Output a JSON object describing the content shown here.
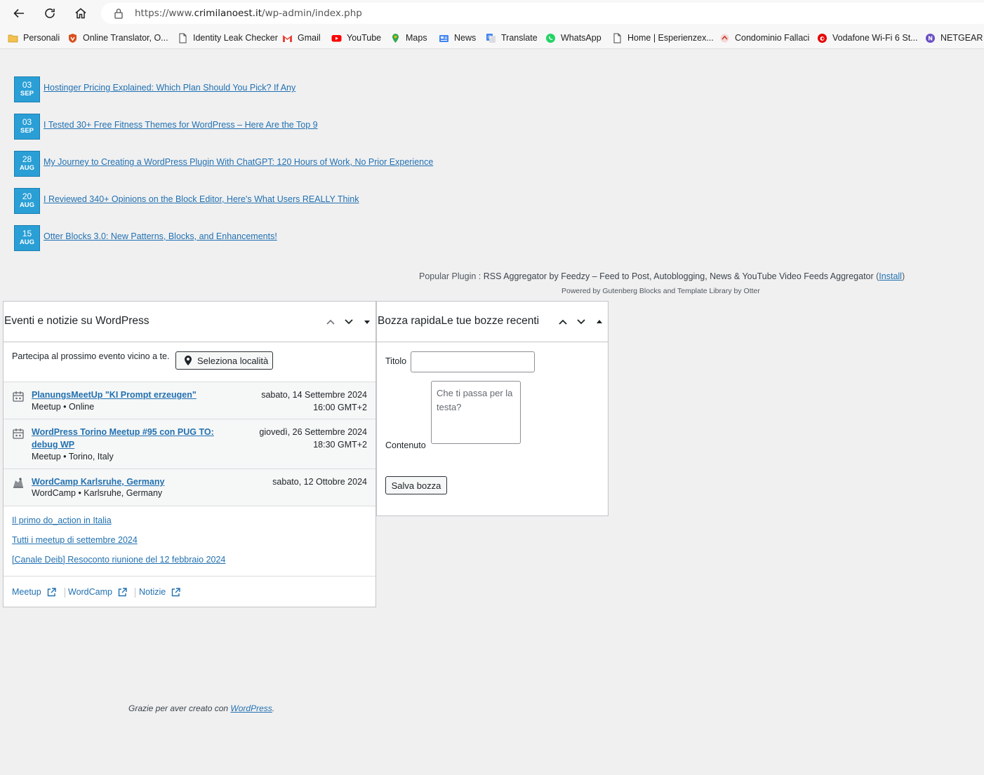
{
  "browser": {
    "url_prefix": "https://www.",
    "url_domain": "crimilanoest.it",
    "url_path": "/wp-admin/index.php"
  },
  "bookmarks": [
    {
      "label": "Personali",
      "icon": "folder-icon",
      "color": "#f2c14e"
    },
    {
      "label": "Online Translator, O...",
      "icon": "translator-icon",
      "color": "#d9501e"
    },
    {
      "label": "Identity Leak Checker",
      "icon": "page-icon",
      "color": "#444444"
    },
    {
      "label": "Gmail",
      "icon": "gmail-icon",
      "color": "#ea4335"
    },
    {
      "label": "YouTube",
      "icon": "youtube-icon",
      "color": "#ff0000"
    },
    {
      "label": "Maps",
      "icon": "maps-icon",
      "color": "#34a853"
    },
    {
      "label": "News",
      "icon": "news-icon",
      "color": "#4285f4"
    },
    {
      "label": "Translate",
      "icon": "translate-icon",
      "color": "#4285f4"
    },
    {
      "label": "WhatsApp",
      "icon": "whatsapp-icon",
      "color": "#25d366"
    },
    {
      "label": "Home | Esperienzex...",
      "icon": "page-icon",
      "color": "#444444"
    },
    {
      "label": "Condominio Fallaci",
      "icon": "condominio-icon",
      "color": "#c0392b"
    },
    {
      "label": "Vodafone Wi-Fi 6 St...",
      "icon": "vodafone-icon",
      "color": "#e60000"
    },
    {
      "label": "NETGEAR Ro",
      "icon": "netgear-icon",
      "color": "#6a4fc4"
    }
  ],
  "news": [
    {
      "day": "03",
      "month": "SEP",
      "title": "Hostinger Pricing Explained: Which Plan Should You Pick? If Any"
    },
    {
      "day": "03",
      "month": "SEP",
      "title": "I Tested 30+ Free Fitness Themes for WordPress – Here Are the Top 9"
    },
    {
      "day": "28",
      "month": "AUG",
      "title": "My Journey to Creating a WordPress Plugin With ChatGPT: 120 Hours of Work, No Prior Experience"
    },
    {
      "day": "20",
      "month": "AUG",
      "title": "I Reviewed 340+ Opinions on the Block Editor, Here's What Users REALLY Think"
    },
    {
      "day": "15",
      "month": "AUG",
      "title": "Otter Blocks 3.0: New Patterns, Blocks, and Enhancements!"
    }
  ],
  "popular": {
    "label": "Popular Plugin : ",
    "name": "RSS Aggregator by Feedzy – Feed to Post, Autoblogging, News & YouTube Video Feeds Aggregator",
    "open_paren": " (",
    "install": "Install",
    "close_paren": ")",
    "powered": "Powered by Gutenberg Blocks and Template Library by Otter"
  },
  "events_panel": {
    "title": "Eventi e notizie su WordPress",
    "location_text": "Partecipa al prossimo evento vicino a te.",
    "location_button": "Seleziona località",
    "events": [
      {
        "title": "PlanungsMeetUp \"KI Prompt erzeugen\"",
        "meta": "Meetup • Online",
        "date": "sabato, 14 Settembre 2024",
        "time": "16:00 GMT+2",
        "icon": "meetup-icon"
      },
      {
        "title_line1": "WordPress Torino Meetup #95 con PUG TO:",
        "title_line2": "debug WP",
        "meta": "Meetup • Torino, Italy",
        "date": "giovedì, 26 Settembre 2024",
        "time": "18:30 GMT+2",
        "icon": "meetup-icon"
      },
      {
        "title": "WordCamp Karlsruhe, Germany",
        "meta": "WordCamp • Karlsruhe, Germany",
        "date": "sabato, 12 Ottobre 2024",
        "icon": "wordcamp-icon"
      }
    ],
    "news_links": [
      "Il primo do_action in Italia",
      "Tutti i meetup di settembre 2024",
      "[Canale Deib] Resoconto riunione del 12 febbraio 2024"
    ],
    "footer": {
      "meetup": "Meetup",
      "wordcamp": "WordCamp",
      "news": "Notizie"
    }
  },
  "draft_panel": {
    "title": "Bozza rapidaLe tue bozze recenti",
    "title_label": "Titolo",
    "title_value": "",
    "content_label": "Contenuto",
    "content_placeholder": "Che ti passa per la testa?",
    "save_button": "Salva bozza"
  },
  "footer": {
    "thanks_prefix": "Grazie per aver creato con ",
    "thanks_link": "WordPress",
    "thanks_suffix": "."
  }
}
